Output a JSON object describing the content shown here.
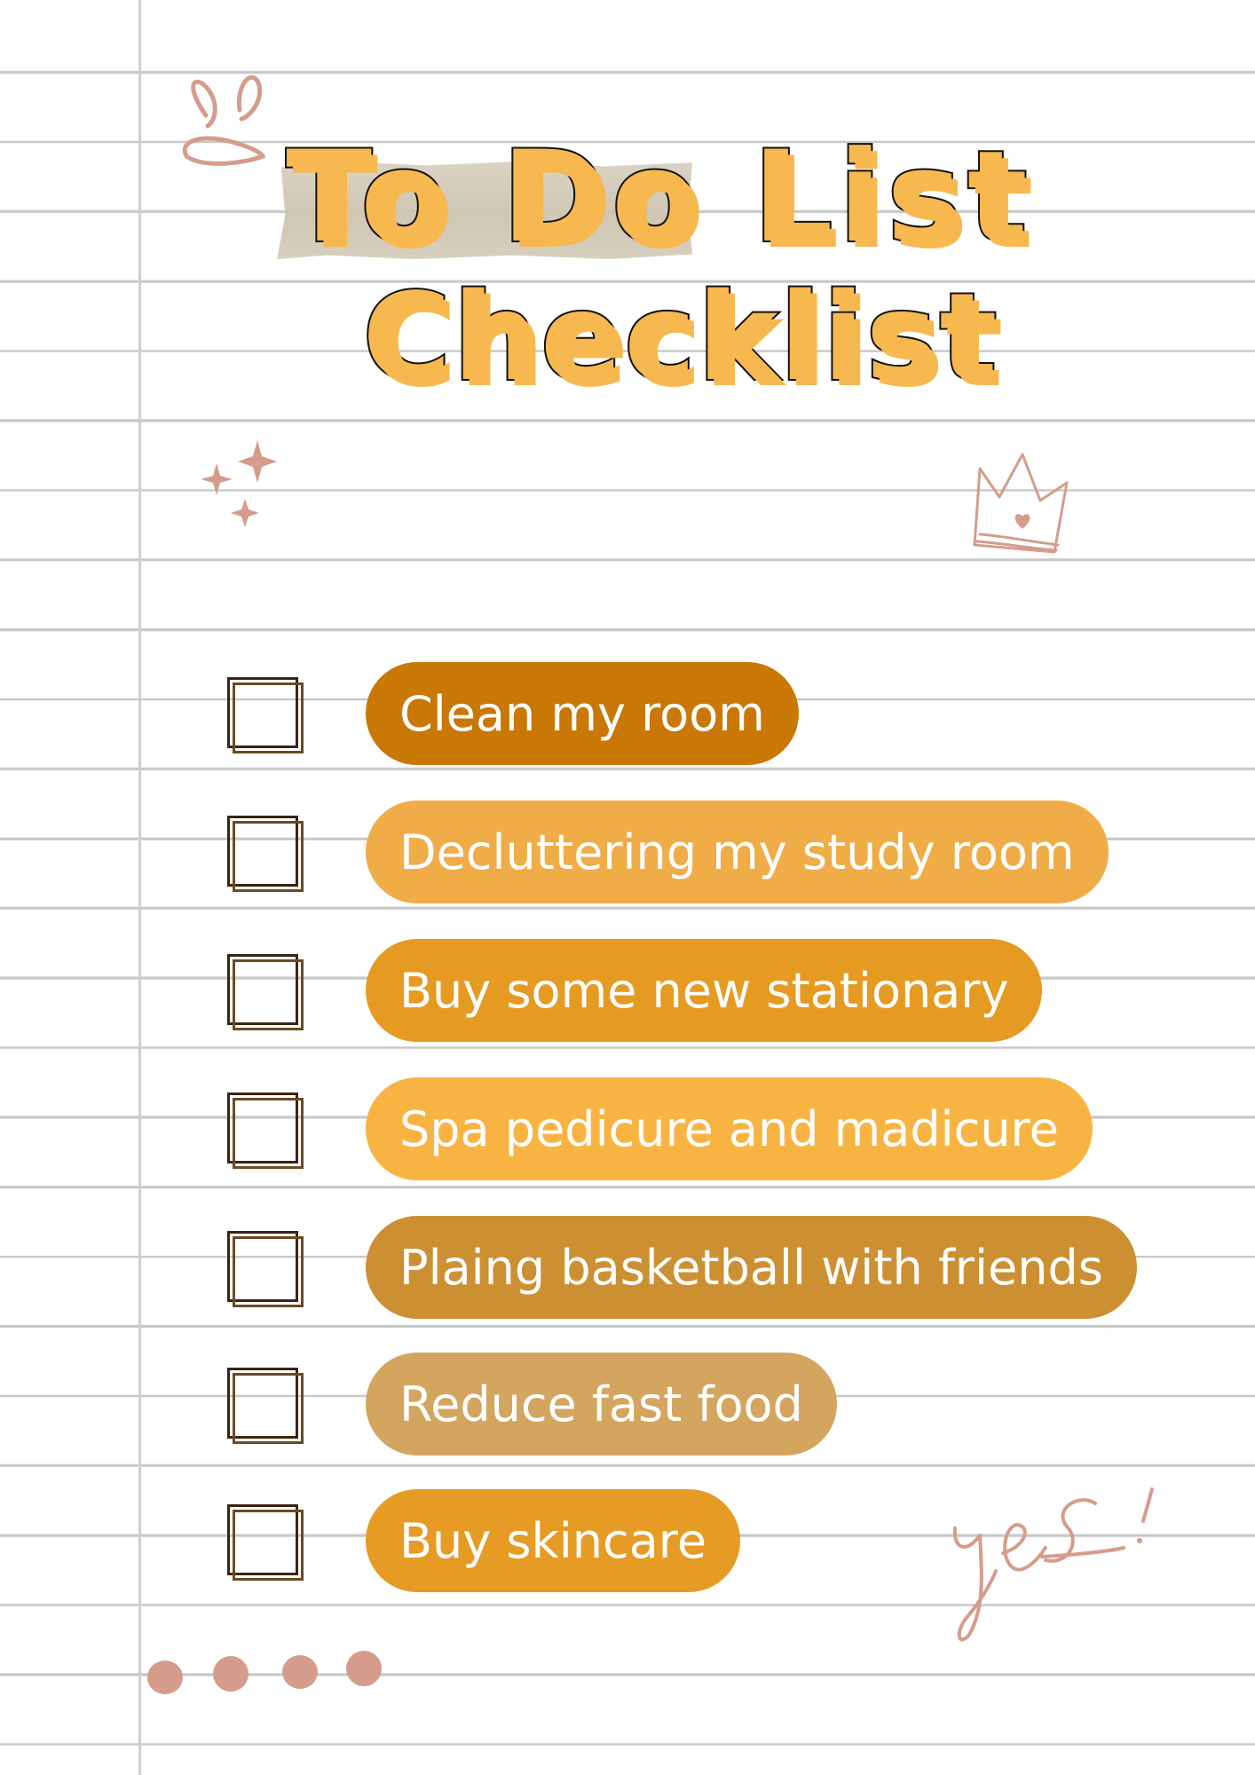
{
  "title": {
    "line1": "To Do List",
    "line2": "Checklist"
  },
  "colors": {
    "title_fill": "#f6b84f",
    "title_outline": "#111111",
    "doodle": "#d59c8c",
    "ruled_line": "#c9c9c9"
  },
  "decorations": {
    "handwriting": "yes !",
    "icons": [
      "flower-burst-icon",
      "sparkles-icon",
      "crown-icon",
      "dots-icon"
    ]
  },
  "tasks": [
    {
      "label": "Clean my room",
      "color": "#c97805",
      "checked": false
    },
    {
      "label": "Decluttering my study room",
      "color": "#f0ac47",
      "checked": false
    },
    {
      "label": "Buy some new stationary",
      "color": "#e59a22",
      "checked": false
    },
    {
      "label": "Spa pedicure and madicure",
      "color": "#f8b443",
      "checked": false
    },
    {
      "label": "Plaing basketball with friends",
      "color": "#cc9033",
      "checked": false
    },
    {
      "label": "Reduce fast food",
      "color": "#d4a55e",
      "checked": false
    },
    {
      "label": "Buy skincare",
      "color": "#e69b24",
      "checked": false
    }
  ]
}
